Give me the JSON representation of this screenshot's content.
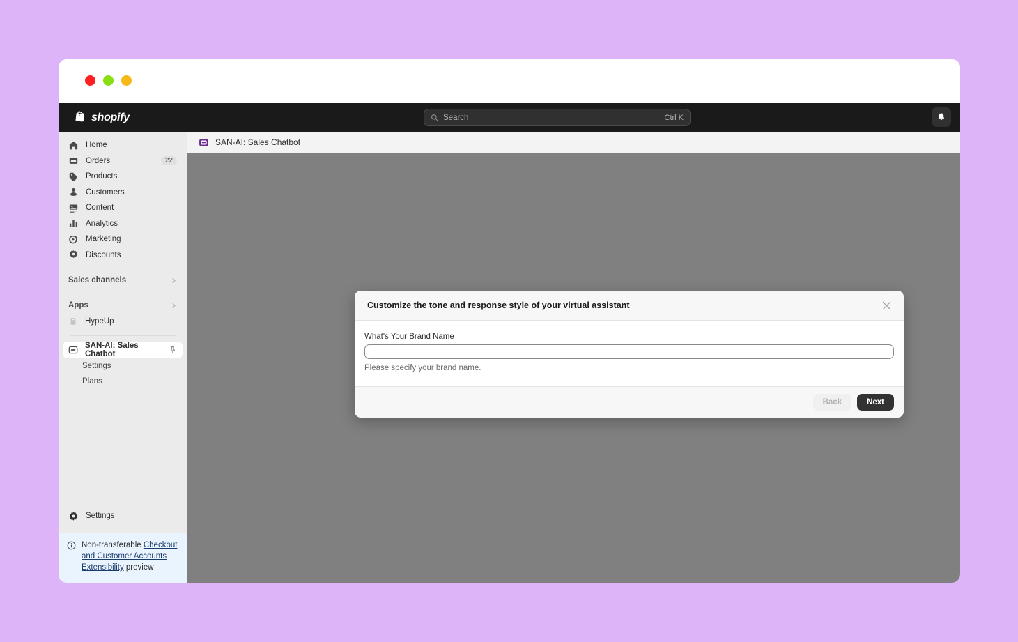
{
  "theme": {
    "page_background": "#ddb4f8",
    "topbar_background": "#1a1a1a",
    "sidebar_background": "#ebebeb",
    "canvas_background": "#808080",
    "accent_purple": "#6b2d8f",
    "banner_background": "#eaf4fe",
    "primary_button": "#323232"
  },
  "window_controls": [
    {
      "name": "close",
      "color": "#fc2020"
    },
    {
      "name": "minimize",
      "color": "#8ade14"
    },
    {
      "name": "maximize",
      "color": "#f6b91a"
    }
  ],
  "topbar": {
    "brand": "shopify",
    "brand_icon": "shopify-bag-icon",
    "search": {
      "icon": "search-icon",
      "placeholder": "Search",
      "shortcut": "Ctrl K",
      "value": ""
    },
    "notifications_icon": "bell-icon"
  },
  "sidebar": {
    "nav_items": [
      {
        "label": "Home",
        "icon": "home-icon",
        "badge": null,
        "active": false
      },
      {
        "label": "Orders",
        "icon": "orders-inbox-icon",
        "badge": "22",
        "active": false
      },
      {
        "label": "Products",
        "icon": "products-tag-icon",
        "badge": null,
        "active": false
      },
      {
        "label": "Customers",
        "icon": "customers-person-icon",
        "badge": null,
        "active": false
      },
      {
        "label": "Content",
        "icon": "content-image-icon",
        "badge": null,
        "active": false
      },
      {
        "label": "Analytics",
        "icon": "analytics-bars-icon",
        "badge": null,
        "active": false
      },
      {
        "label": "Marketing",
        "icon": "marketing-target-icon",
        "badge": null,
        "active": false
      },
      {
        "label": "Discounts",
        "icon": "discounts-badge-icon",
        "badge": null,
        "active": false
      }
    ],
    "sections": [
      {
        "label": "Sales channels",
        "icon": "chevron-right-icon"
      },
      {
        "label": "Apps",
        "icon": "chevron-right-icon"
      }
    ],
    "apps": [
      {
        "label": "HypeUp",
        "icon": "hypeup-app-icon",
        "active": false,
        "pinned": false
      },
      {
        "label": "SAN-AI: Sales Chatbot",
        "icon": "chatbot-icon",
        "active": true,
        "pinned": true,
        "pin_icon": "pin-icon"
      }
    ],
    "app_subitems": [
      {
        "label": "Settings"
      },
      {
        "label": "Plans"
      }
    ],
    "settings": {
      "label": "Settings",
      "icon": "gear-icon"
    },
    "banner": {
      "icon": "info-circle-icon",
      "text_before": "Non-transferable ",
      "link_text": "Checkout and Customer Accounts Extensibility",
      "text_after": " preview"
    }
  },
  "app_header": {
    "icon": "chatbot-icon",
    "title": "SAN-AI: Sales Chatbot"
  },
  "modal": {
    "title": "Customize the tone and response style of your virtual assistant",
    "close_icon": "close-icon",
    "field": {
      "label": "What's Your Brand Name",
      "value": "",
      "placeholder": "",
      "help_text": "Please specify your brand name."
    },
    "buttons": {
      "back": "Back",
      "next": "Next"
    }
  }
}
